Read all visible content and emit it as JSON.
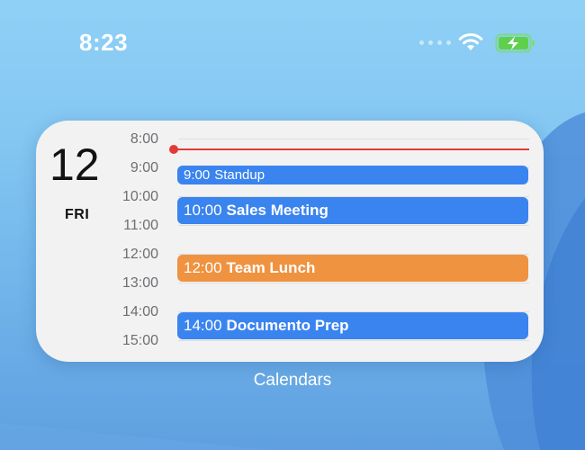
{
  "status_bar": {
    "time": "8:23"
  },
  "widget": {
    "date": {
      "day_number": "12",
      "day_name": "FRI"
    },
    "hours": [
      "8:00",
      "9:00",
      "10:00",
      "11:00",
      "12:00",
      "13:00",
      "14:00",
      "15:00"
    ],
    "events": [
      {
        "time": "9:00",
        "title": "Standup",
        "color": "#3a84ef"
      },
      {
        "time": "10:00",
        "title": "Sales Meeting",
        "color": "#3a84ef"
      },
      {
        "time": "12:00",
        "title": "Team Lunch",
        "color": "#ef9340"
      },
      {
        "time": "14:00",
        "title": "Documento Prep",
        "color": "#3a84ef"
      }
    ],
    "current_time_indicator_color": "#e23b36"
  },
  "caption": "Calendars"
}
